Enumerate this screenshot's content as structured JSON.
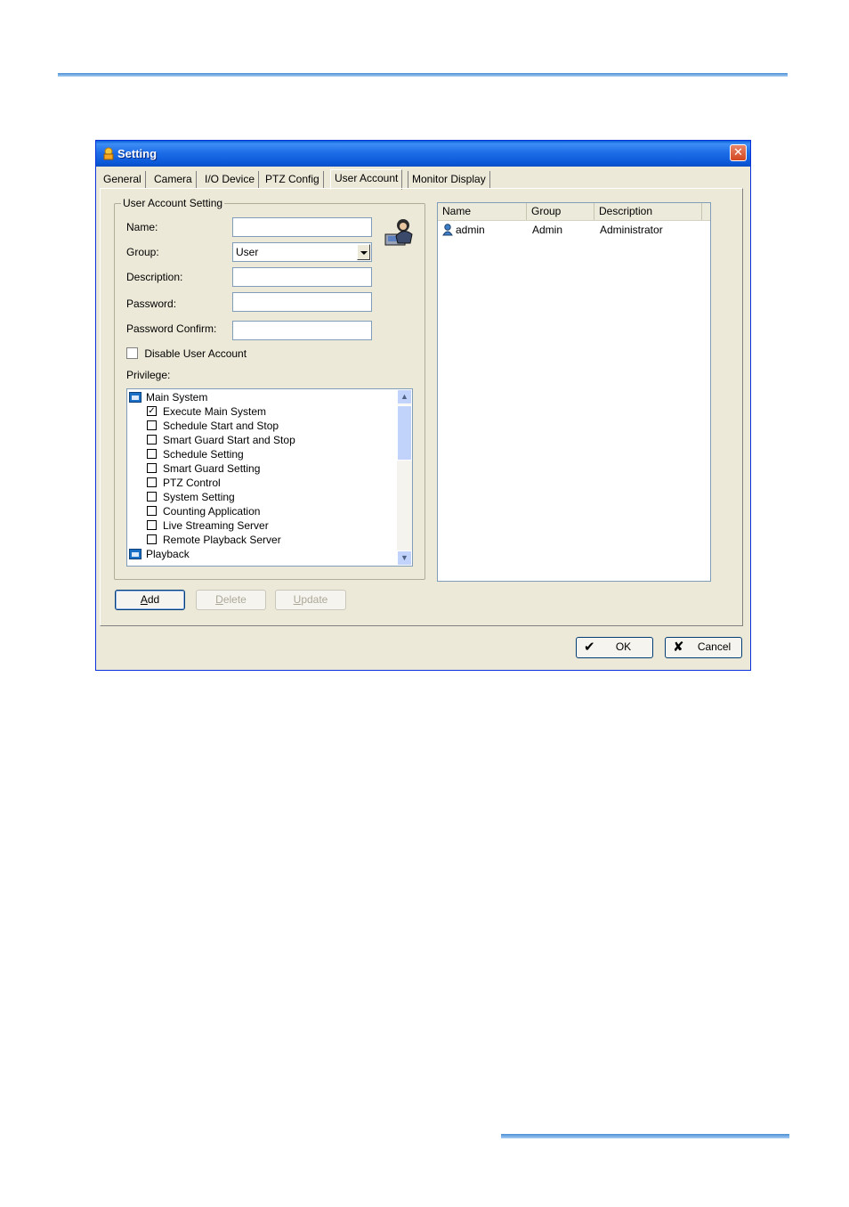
{
  "window": {
    "title": "Setting",
    "close_glyph": "✕"
  },
  "tabs": [
    {
      "label": "General"
    },
    {
      "label": "Camera"
    },
    {
      "label": "I/O Device"
    },
    {
      "label": "PTZ Config"
    },
    {
      "label": "User Account",
      "active": true
    },
    {
      "label": "Monitor Display"
    }
  ],
  "user_account_setting": {
    "legend": "User Account Setting",
    "name_label": "Name:",
    "name_value": "",
    "group_label": "Group:",
    "group_value": "User",
    "description_label": "Description:",
    "description_value": "",
    "password_label": "Password:",
    "password_value": "",
    "password_confirm_label": "Password Confirm:",
    "password_confirm_value": "",
    "disable_label": "Disable User Account",
    "disable_checked": false,
    "privilege_label": "Privilege:"
  },
  "privilege_tree": [
    {
      "label": "Main System",
      "type": "folder",
      "icon": "folder-icon"
    },
    {
      "label": "Execute Main System",
      "type": "check",
      "checked": true
    },
    {
      "label": "Schedule Start and Stop",
      "type": "check",
      "checked": false
    },
    {
      "label": "Smart Guard Start and Stop",
      "type": "check",
      "checked": false
    },
    {
      "label": "Schedule Setting",
      "type": "check",
      "checked": false
    },
    {
      "label": "Smart Guard Setting",
      "type": "check",
      "checked": false
    },
    {
      "label": "PTZ Control",
      "type": "check",
      "checked": false
    },
    {
      "label": "System Setting",
      "type": "check",
      "checked": false
    },
    {
      "label": "Counting Application",
      "type": "check",
      "checked": false
    },
    {
      "label": "Live Streaming Server",
      "type": "check",
      "checked": false
    },
    {
      "label": "Remote Playback Server",
      "type": "check",
      "checked": false
    },
    {
      "label": "Playback",
      "type": "folder",
      "icon": "folder-icon"
    }
  ],
  "user_list": {
    "columns": [
      "Name",
      "Group",
      "Description"
    ],
    "rows": [
      {
        "name": "admin",
        "group": "Admin",
        "description": "Administrator"
      }
    ]
  },
  "actions": {
    "add_pre": "",
    "add_key": "A",
    "add_post": "dd",
    "delete_pre": "",
    "delete_key": "D",
    "delete_post": "elete",
    "update_pre": "",
    "update_key": "U",
    "update_post": "pdate"
  },
  "footer": {
    "ok_label": "OK",
    "cancel_label": "Cancel",
    "ok_glyph": "✔",
    "cancel_glyph": "✘"
  },
  "scroll": {
    "up_glyph": "▲",
    "down_glyph": "▼"
  },
  "colors": {
    "title_blue": "#0a5fd8",
    "frame": "#ece9d8",
    "close_red": "#d3461f"
  }
}
